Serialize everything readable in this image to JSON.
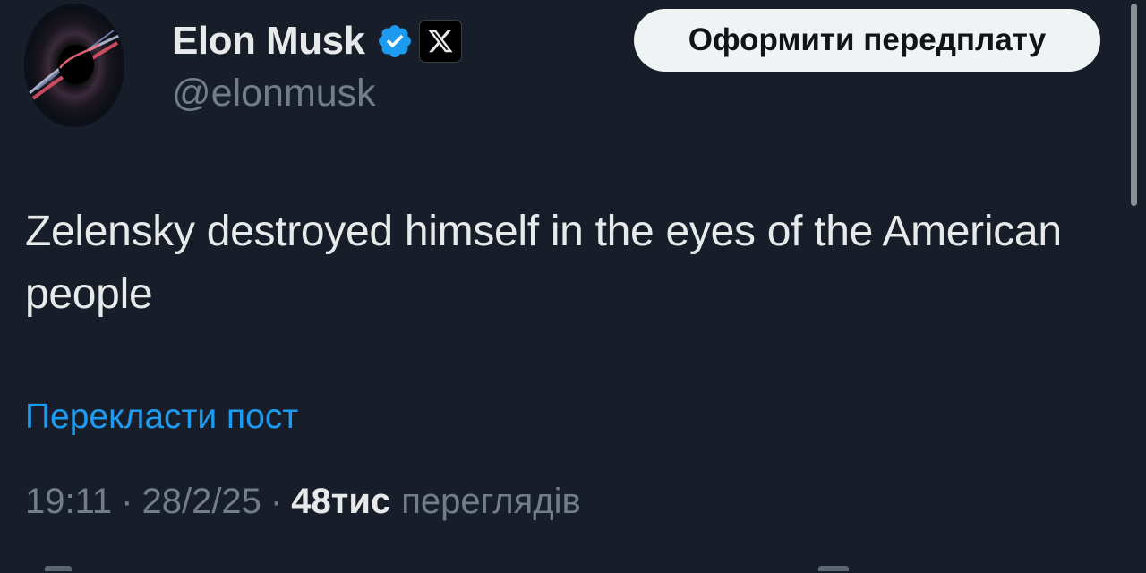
{
  "author": {
    "display_name": "Elon Musk",
    "handle": "@elonmusk",
    "verified": true,
    "affiliate_badge": "x-logo-icon"
  },
  "actions": {
    "subscribe_label": "Оформити передплату"
  },
  "tweet": {
    "text": "Zelensky destroyed himself in the eyes of the American people",
    "translate_label": "Перекласти пост"
  },
  "meta": {
    "time": "19:11",
    "separator": "·",
    "date": "28/2/25",
    "views_count": "48тис",
    "views_label": "переглядів"
  },
  "colors": {
    "background": "#171e29",
    "text_primary": "#e7e9ea",
    "text_secondary": "#717d8a",
    "link": "#1d9bf0",
    "verified": "#1d9bf0",
    "button_bg": "#eff3f4"
  }
}
